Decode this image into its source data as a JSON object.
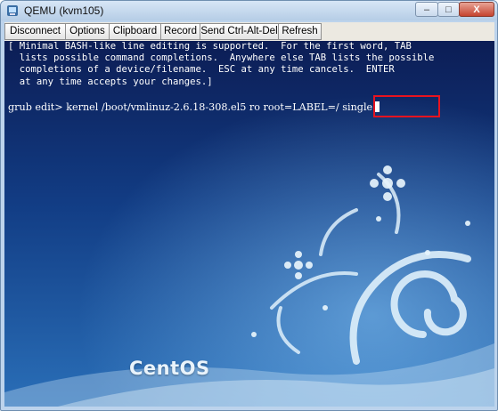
{
  "window": {
    "title": "QEMU (kvm105)",
    "controls": {
      "minimize": "–",
      "maximize": "□",
      "close": "X"
    }
  },
  "toolbar": {
    "buttons": [
      "Disconnect",
      "Options",
      "Clipboard",
      "Record",
      "Send Ctrl-Alt-Del",
      "Refresh"
    ]
  },
  "terminal": {
    "lines": [
      "[ Minimal BASH-like line editing is supported.  For the first word, TAB",
      "  lists possible command completions.  Anywhere else TAB lists the possible",
      "  completions of a device/filename.  ESC at any time cancels.  ENTER",
      "  at any time accepts your changes.]"
    ],
    "command_line": "grub edit> kernel /boot/vmlinuz-2.6.18-308.el5 ro root=LABEL=/ single"
  },
  "desktop": {
    "brand": "CentOS"
  },
  "colors": {
    "highlight": "#e8131f",
    "terminal_text": "#ffffff",
    "background_dark": "#0c1d55",
    "background_light": "#2a6fb8"
  },
  "icons": [
    "qemu-app-icon",
    "minimize-icon",
    "maximize-icon",
    "close-icon",
    "text-cursor",
    "centos-swirl-artwork"
  ]
}
